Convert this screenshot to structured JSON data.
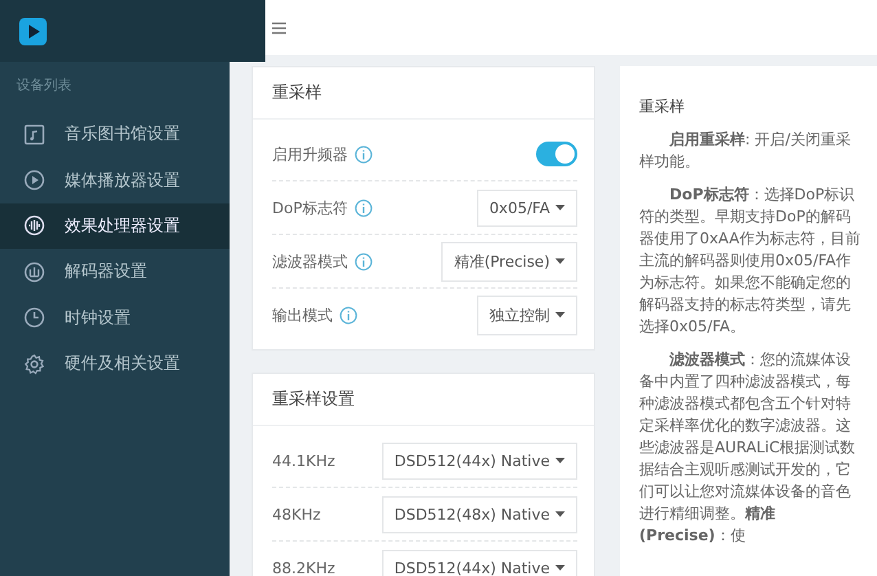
{
  "sidebar": {
    "section_label": "设备列表",
    "items": [
      {
        "label": "音乐图书馆设置",
        "kind": "library",
        "selected": false
      },
      {
        "label": "媒体播放器设置",
        "kind": "player",
        "selected": false
      },
      {
        "label": "效果处理器设置",
        "kind": "effects",
        "selected": true
      },
      {
        "label": "解码器设置",
        "kind": "decoder",
        "selected": false
      },
      {
        "label": "时钟设置",
        "kind": "clock",
        "selected": false
      },
      {
        "label": "硬件及相关设置",
        "kind": "hardware",
        "selected": false
      }
    ]
  },
  "resample_card": {
    "title": "重采样",
    "rows": [
      {
        "kind": "toggle",
        "label": "启用升频器",
        "on": true
      },
      {
        "kind": "select",
        "label": "DoP标志符",
        "value": "0x05/FA"
      },
      {
        "kind": "select",
        "label": "滤波器模式",
        "value": "精准(Precise)"
      },
      {
        "kind": "select",
        "label": "输出模式",
        "value": "独立控制"
      }
    ]
  },
  "resample_settings_card": {
    "title": "重采样设置",
    "rows": [
      {
        "label": "44.1KHz",
        "value": "DSD512(44x) Native"
      },
      {
        "label": "48KHz",
        "value": "DSD512(48x) Native"
      },
      {
        "label": "88.2KHz",
        "value": "DSD512(44x) Native"
      }
    ]
  },
  "help_panel": {
    "title": "重采样",
    "paragraphs": [
      "**启用重采样**: 开启/关闭重采样功能。",
      "**DoP标志符**：选择DoP标识符的类型。早期支持DoP的解码器使用了0xAA作为标志符，目前主流的解码器则使用0x05/FA作为标志符。如果您不能确定您的解码器支持的标志符类型，请先选择0x05/FA。",
      "**滤波器模式**：您的流媒体设备中内置了四种滤波器模式，每种滤波器模式都包含五个针对特定采样率优化的数字滤波器。这些滤波器是AURALiC根据测试数据结合主观听感测试开发的，它们可以让您对流媒体设备的音色进行精细调整。**精准(Precise)**：使"
    ]
  }
}
